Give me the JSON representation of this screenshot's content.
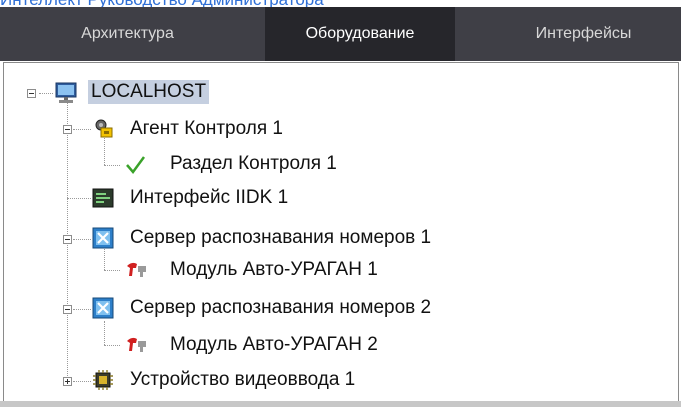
{
  "top_link": "Интеллект Руководство Администратора",
  "tabs": [
    {
      "label": "Архитектура"
    },
    {
      "label": "Оборудование",
      "active": true
    },
    {
      "label": "Интерфейсы"
    }
  ],
  "tree": {
    "root": {
      "label": "LOCALHOST",
      "icon": "computer-icon",
      "expanded": true
    },
    "nodes": [
      {
        "label": "Агент Контроля 1",
        "icon": "control-agent-icon",
        "level": 1,
        "expanded": true
      },
      {
        "label": "Раздел Контроля 1",
        "icon": "checkmark-icon",
        "level": 2
      },
      {
        "label": "Интерфейс IIDK 1",
        "icon": "terminal-icon",
        "level": 1
      },
      {
        "label": "Сервер распознавания номеров 1",
        "icon": "recognition-server-icon",
        "level": 1,
        "expanded": true
      },
      {
        "label": "Модуль Авто-УРАГАН 1",
        "icon": "auto-uragan-icon",
        "level": 2
      },
      {
        "label": "Сервер распознавания номеров 2",
        "icon": "recognition-server-icon",
        "level": 1,
        "expanded": true
      },
      {
        "label": "Модуль Авто-УРАГАН 2",
        "icon": "auto-uragan-icon",
        "level": 2
      },
      {
        "label": "Устройство видеоввода 1",
        "icon": "video-capture-chip-icon",
        "level": 1,
        "expanded": false
      }
    ]
  },
  "colors": {
    "tab_bar": "#3f3f46",
    "tab_active": "#26262b",
    "selection": "#c5cfe0",
    "link": "#2f6fd6"
  }
}
